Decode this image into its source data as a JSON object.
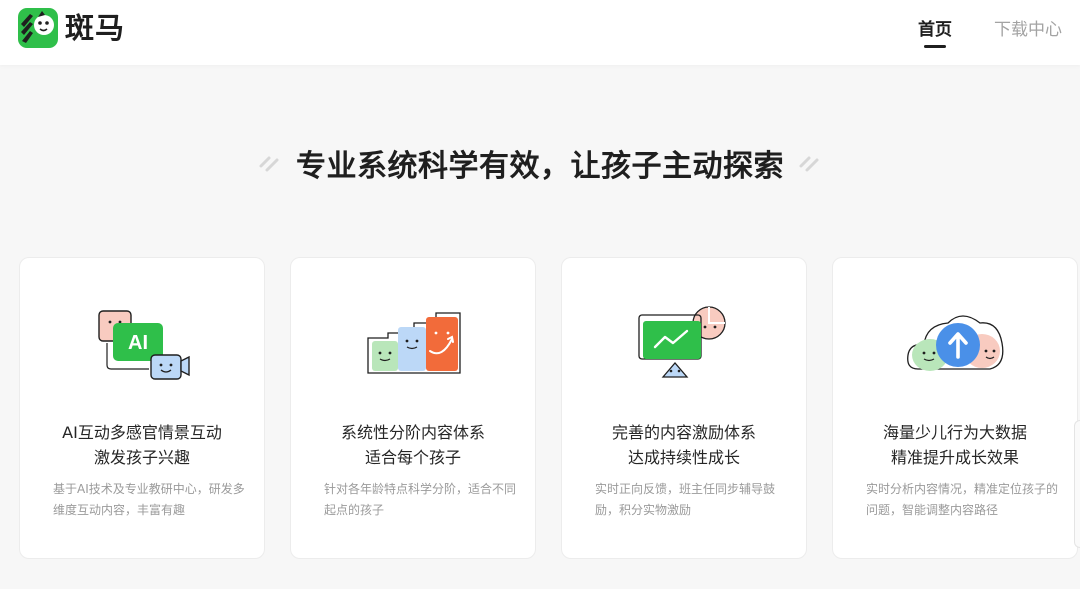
{
  "header": {
    "logo_text": "斑马",
    "nav": [
      {
        "label": "首页",
        "active": true
      },
      {
        "label": "下载中心",
        "active": false
      }
    ]
  },
  "section": {
    "title": "专业系统科学有效，让孩子主动探索"
  },
  "cards": [
    {
      "title": "AI互动多感官情景互动\n激发孩子兴趣",
      "desc": "基于AI技术及专业教研中心，研发多维度互动内容，丰富有趣",
      "icon_label": "AI",
      "icon": "ai-chat-illustration"
    },
    {
      "title": "系统性分阶内容体系\n适合每个孩子",
      "desc": "针对各年龄特点科学分阶，适合不同起点的孩子",
      "icon": "staged-faces-illustration"
    },
    {
      "title": "完善的内容激励体系\n达成持续性成长",
      "desc": "实时正向反馈，班主任同步辅导鼓励，积分实物激励",
      "icon": "growth-screen-illustration"
    },
    {
      "title": "海量少儿行为大数据\n精准提升成长效果",
      "desc": "实时分析内容情况，精准定位孩子的问题，智能调整内容路径",
      "icon": "data-cloud-illustration"
    }
  ],
  "colors": {
    "brand_green": "#2fbf4a",
    "accent_orange": "#f26b3a",
    "accent_blue": "#4a90e8",
    "page_bg": "#f7f7f7"
  }
}
